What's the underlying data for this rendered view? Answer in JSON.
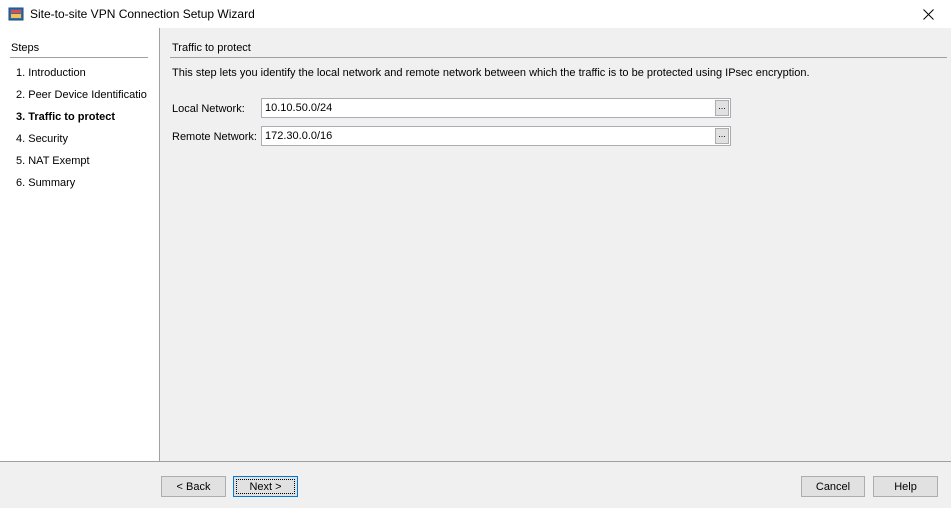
{
  "window": {
    "title": "Site-to-site VPN Connection Setup Wizard"
  },
  "sidebar": {
    "header": "Steps",
    "items": [
      {
        "label": "1.  Introduction",
        "active": false
      },
      {
        "label": "2.  Peer Device Identificatio",
        "active": false
      },
      {
        "label": "3.  Traffic to protect",
        "active": true
      },
      {
        "label": "4.  Security",
        "active": false
      },
      {
        "label": "5.  NAT Exempt",
        "active": false
      },
      {
        "label": "6.  Summary",
        "active": false
      }
    ]
  },
  "main": {
    "section_title": "Traffic to protect",
    "description": "This step lets you identify the local network and remote network between which the traffic is to be protected using IPsec encryption.",
    "local_network": {
      "label": "Local Network:",
      "value": "10.10.50.0/24",
      "browse_label": "..."
    },
    "remote_network": {
      "label": "Remote Network:",
      "value": "172.30.0.0/16",
      "browse_label": "..."
    }
  },
  "footer": {
    "back_label": "< Back",
    "next_label": "Next >",
    "cancel_label": "Cancel",
    "help_label": "Help"
  },
  "colors": {
    "panel_bg": "#f0f0f0",
    "focus_border": "#0078d7"
  }
}
